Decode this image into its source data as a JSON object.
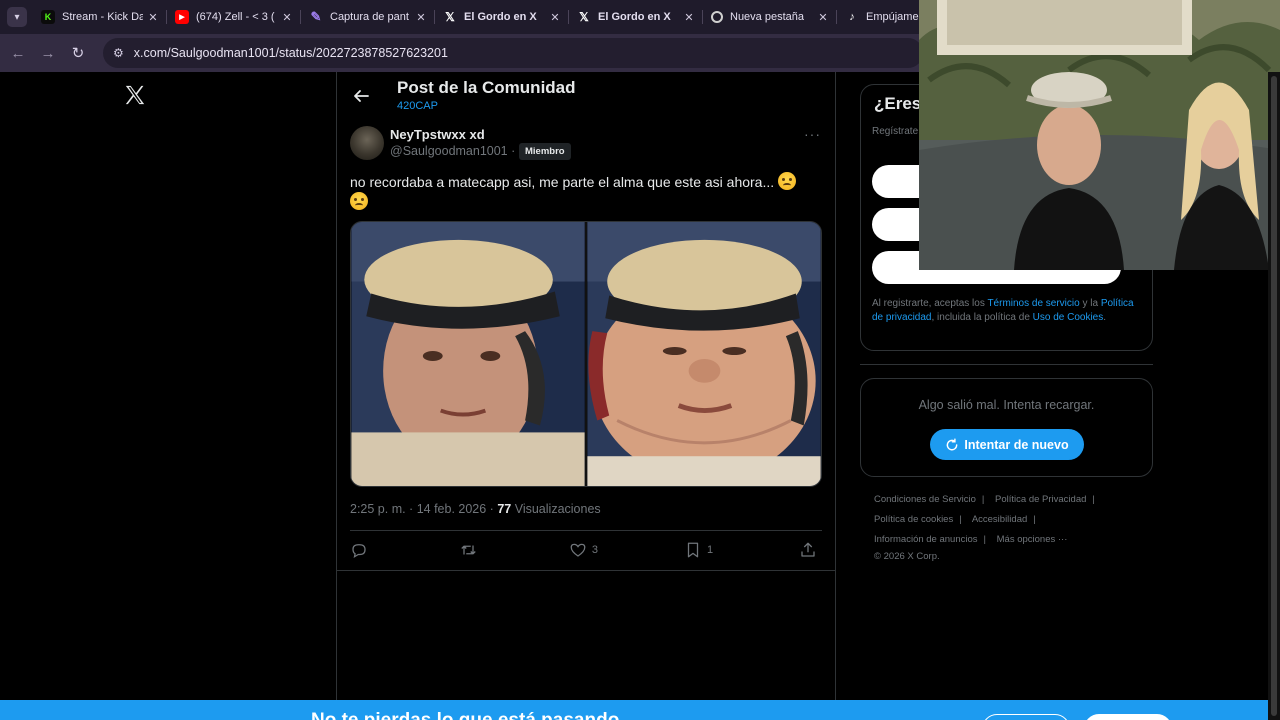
{
  "browser": {
    "tabs": [
      {
        "title": "Stream - Kick Da",
        "icon": "kick-icon",
        "color": "#53fc18"
      },
      {
        "title": "(674) Zell - < 3 (",
        "icon": "youtube-icon",
        "color": "#ff0000"
      },
      {
        "title": "Captura de pant",
        "icon": "feather-icon",
        "color": "#9b7be8"
      },
      {
        "title": "El Gordo en X",
        "icon": "x-icon",
        "color": "#ffffff"
      },
      {
        "title": "El Gordo en X",
        "icon": "x-icon",
        "color": "#ffffff"
      },
      {
        "title": "Nueva pestaña",
        "icon": "chrome-icon",
        "color": "#d0d0d0"
      },
      {
        "title": "Empújamelo C",
        "icon": "tiktok-icon",
        "color": "#ffffff"
      }
    ],
    "url": "x.com/Saulgoodman1001/status/2022723878527623201"
  },
  "header": {
    "title": "Post de la Comunidad",
    "community": "420CAP"
  },
  "post": {
    "author_name": "NeyTpstwxx xd",
    "author_handle": "@Saulgoodman1001 ·",
    "badge": "Miembro",
    "text": "no recordaba a matecapp asi, me parte el alma que este asi ahora...",
    "time": "2:25 p. m. · 14 feb. 2026 ·",
    "views_count": "77",
    "views_label": "Visualizaciones",
    "likes": "3",
    "bookmarks": "1"
  },
  "signup": {
    "heading": "¿Eres",
    "desc": "Regístrate ... personali",
    "legal_prefix": "Al registrarte, aceptas los ",
    "terms": "Términos de servicio",
    "legal_mid1": " y la ",
    "privacy": "Política de privacidad",
    "legal_mid2": ", incluida la política de ",
    "cookies": "Uso de Cookies",
    "legal_end": "."
  },
  "trends_error": {
    "message": "Algo salió mal. Intenta recargar.",
    "retry_label": "Intentar de nuevo"
  },
  "footer": {
    "links": [
      "Condiciones de Servicio",
      "Política de Privacidad",
      "Política de cookies",
      "Accesibilidad",
      "Información de anuncios",
      "Más opciones ···"
    ],
    "copyright": "© 2026 X Corp."
  },
  "bottom_banner": {
    "text": "No te pierdas lo que está pasando"
  },
  "colors": {
    "accent": "#1d9bf0",
    "background": "#000000",
    "border": "#2f3336",
    "muted": "#71767b"
  }
}
